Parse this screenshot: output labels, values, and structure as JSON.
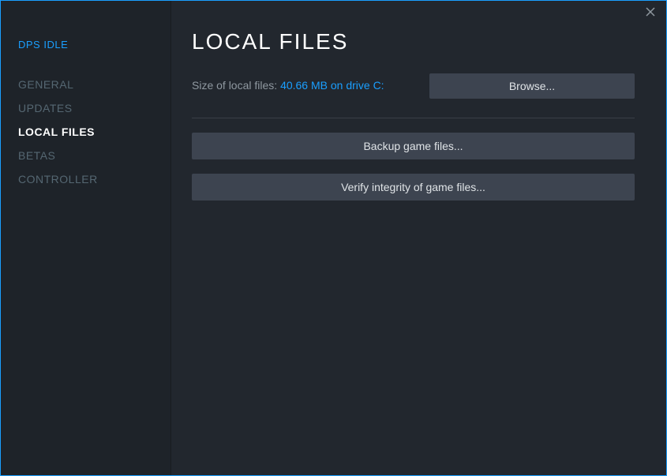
{
  "sidebar": {
    "title": "DPS IDLE",
    "items": [
      {
        "label": "GENERAL"
      },
      {
        "label": "UPDATES"
      },
      {
        "label": "LOCAL FILES"
      },
      {
        "label": "BETAS"
      },
      {
        "label": "CONTROLLER"
      }
    ],
    "active_index": 2
  },
  "main": {
    "title": "LOCAL FILES",
    "size_label": "Size of local files: ",
    "size_value": "40.66 MB on drive C:",
    "browse_label": "Browse...",
    "backup_label": "Backup game files...",
    "verify_label": "Verify integrity of game files..."
  }
}
